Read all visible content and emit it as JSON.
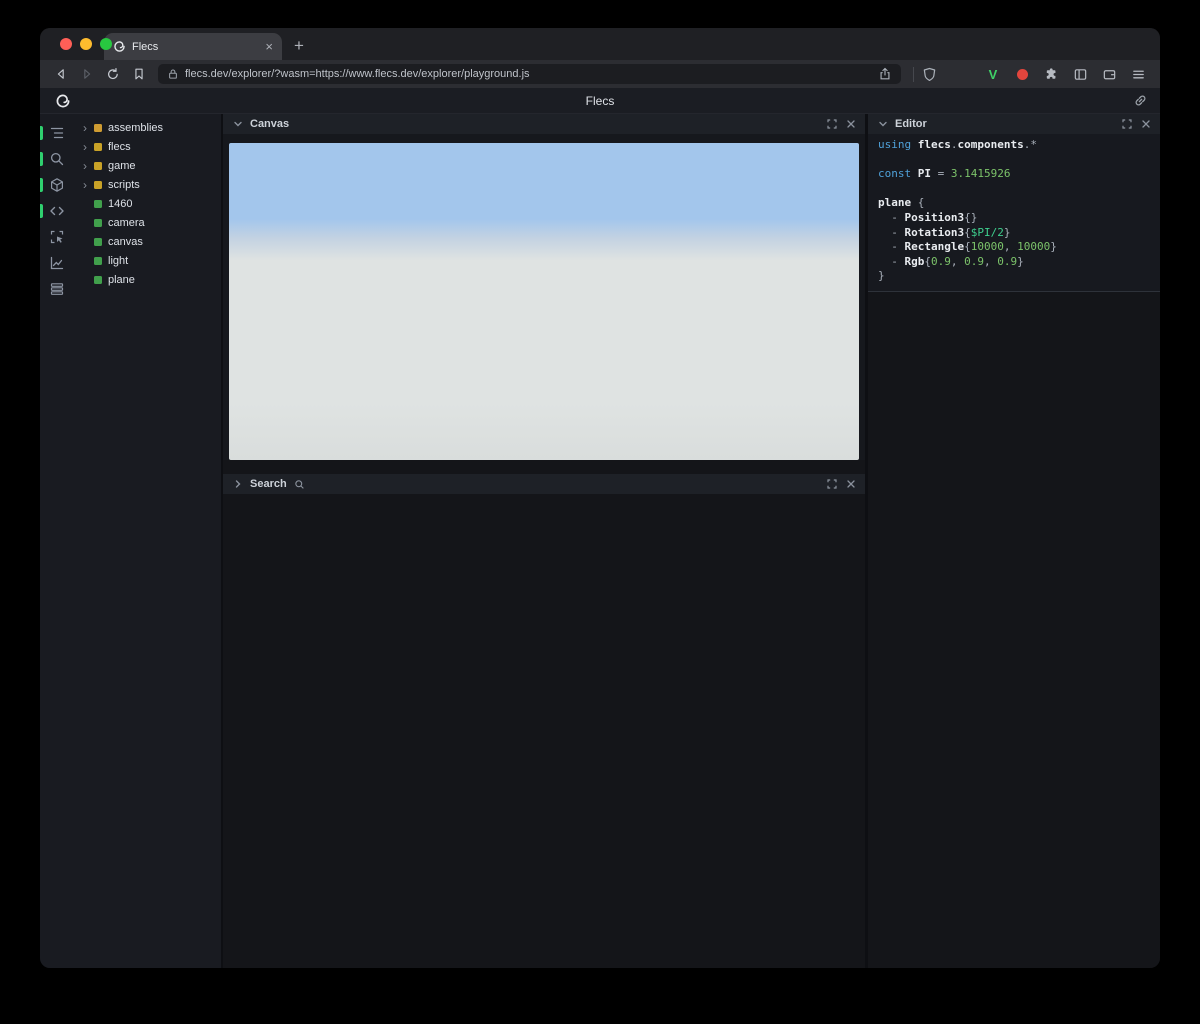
{
  "browser": {
    "traffic_colors": {
      "close": "#ff5f57",
      "minimize": "#febc2e",
      "zoom": "#28c840"
    },
    "tab_title": "Flecs",
    "new_tab_label": "+",
    "url": "flecs.dev/explorer/?wasm=https://www.flecs.dev/explorer/playground.js"
  },
  "app": {
    "title": "Flecs"
  },
  "sidebar": {
    "indicator_color": "#2fd06f",
    "icons": [
      {
        "name": "entity-tree",
        "active": true
      },
      {
        "name": "search",
        "active": true
      },
      {
        "name": "entities",
        "active": true
      },
      {
        "name": "code",
        "active": true
      },
      {
        "name": "inspect",
        "active": false
      },
      {
        "name": "stats",
        "active": false
      },
      {
        "name": "queries",
        "active": false
      }
    ]
  },
  "tree": {
    "items": [
      {
        "label": "assemblies",
        "expandable": true,
        "color": "#cf9c32"
      },
      {
        "label": "flecs",
        "expandable": true,
        "color": "#c9a227"
      },
      {
        "label": "game",
        "expandable": true,
        "color": "#c9a227"
      },
      {
        "label": "scripts",
        "expandable": true,
        "color": "#c9a227"
      },
      {
        "label": "1460",
        "expandable": false,
        "color": "#41a04c"
      },
      {
        "label": "camera",
        "expandable": false,
        "color": "#41a04c"
      },
      {
        "label": "canvas",
        "expandable": false,
        "color": "#41a04c"
      },
      {
        "label": "light",
        "expandable": false,
        "color": "#41a04c"
      },
      {
        "label": "plane",
        "expandable": false,
        "color": "#41a04c"
      }
    ]
  },
  "panels": {
    "canvas": {
      "title": "Canvas",
      "collapsed": false
    },
    "search": {
      "title": "Search",
      "collapsed": true
    },
    "editor": {
      "title": "Editor",
      "collapsed": false
    }
  },
  "canvas_scene": {
    "sky_color": "#a3c6ec",
    "ground_color": "#dfe3e2"
  },
  "editor": {
    "token_colors": {
      "kw": "#4fa0d8",
      "id": "#e9ecf0",
      "pn": "#aab1bb",
      "num": "#7cc36a",
      "var": "#3ecf8e"
    },
    "lines": [
      [
        {
          "t": "using ",
          "c": "kw"
        },
        {
          "t": "flecs",
          "c": "id"
        },
        {
          "t": ".",
          "c": "pn"
        },
        {
          "t": "components",
          "c": "id"
        },
        {
          "t": ".*",
          "c": "pn"
        }
      ],
      [],
      [
        {
          "t": "const ",
          "c": "kw"
        },
        {
          "t": "PI",
          "c": "id"
        },
        {
          "t": " = ",
          "c": "pn"
        },
        {
          "t": "3.1415926",
          "c": "num"
        }
      ],
      [],
      [
        {
          "t": "plane",
          "c": "id"
        },
        {
          "t": " {",
          "c": "pn"
        }
      ],
      [
        {
          "t": "  - ",
          "c": "pn"
        },
        {
          "t": "Position3",
          "c": "id"
        },
        {
          "t": "{}",
          "c": "pn"
        }
      ],
      [
        {
          "t": "  - ",
          "c": "pn"
        },
        {
          "t": "Rotation3",
          "c": "id"
        },
        {
          "t": "{",
          "c": "pn"
        },
        {
          "t": "$PI/2",
          "c": "var"
        },
        {
          "t": "}",
          "c": "pn"
        }
      ],
      [
        {
          "t": "  - ",
          "c": "pn"
        },
        {
          "t": "Rectangle",
          "c": "id"
        },
        {
          "t": "{",
          "c": "pn"
        },
        {
          "t": "10000",
          "c": "num"
        },
        {
          "t": ", ",
          "c": "pn"
        },
        {
          "t": "10000",
          "c": "num"
        },
        {
          "t": "}",
          "c": "pn"
        }
      ],
      [
        {
          "t": "  - ",
          "c": "pn"
        },
        {
          "t": "Rgb",
          "c": "id"
        },
        {
          "t": "{",
          "c": "pn"
        },
        {
          "t": "0.9",
          "c": "num"
        },
        {
          "t": ", ",
          "c": "pn"
        },
        {
          "t": "0.9",
          "c": "num"
        },
        {
          "t": ", ",
          "c": "pn"
        },
        {
          "t": "0.9",
          "c": "num"
        },
        {
          "t": "}",
          "c": "pn"
        }
      ],
      [
        {
          "t": "}",
          "c": "pn"
        }
      ]
    ]
  }
}
